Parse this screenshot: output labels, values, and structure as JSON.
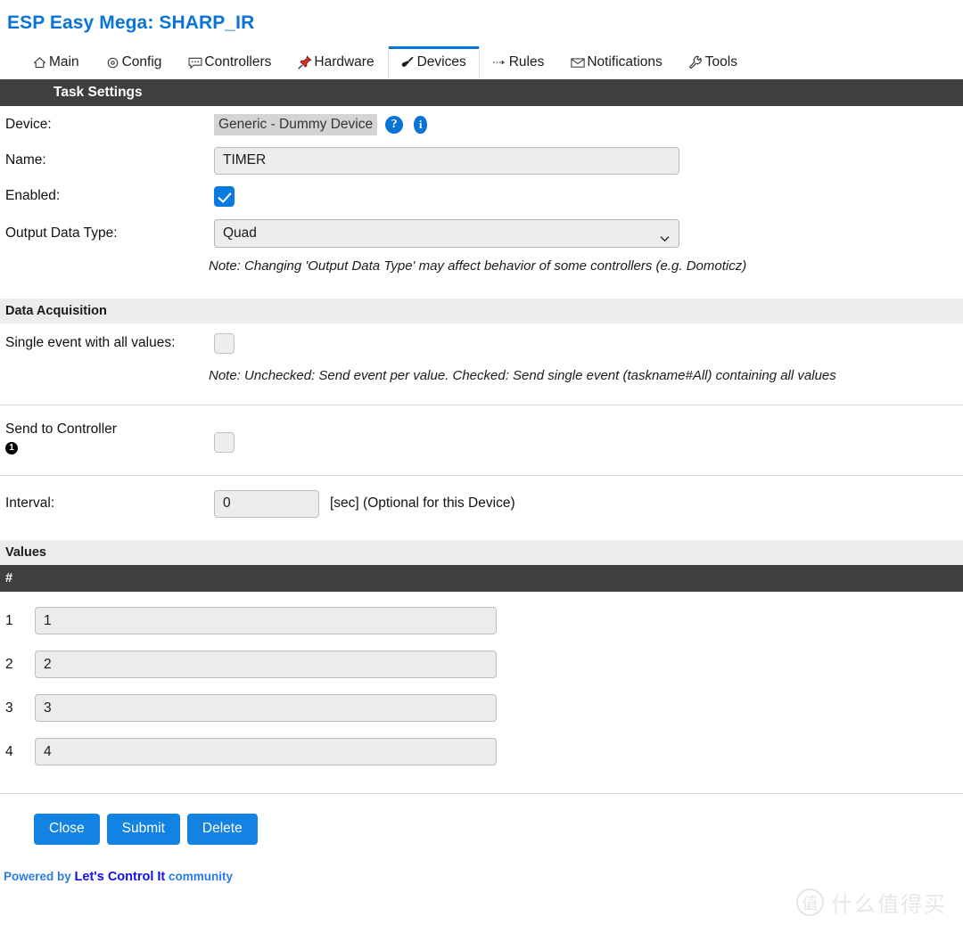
{
  "header": {
    "title": "ESP Easy Mega: SHARP_IR"
  },
  "tabs": [
    {
      "label": "Main",
      "icon": "home-icon",
      "active": false
    },
    {
      "label": "Config",
      "icon": "gear-icon",
      "active": false
    },
    {
      "label": "Controllers",
      "icon": "chat-icon",
      "active": false
    },
    {
      "label": "Hardware",
      "icon": "pushpin-icon",
      "active": false
    },
    {
      "label": "Devices",
      "icon": "plug-icon",
      "active": true
    },
    {
      "label": "Rules",
      "icon": "arrow-icon",
      "active": false
    },
    {
      "label": "Notifications",
      "icon": "envelope-icon",
      "active": false
    },
    {
      "label": "Tools",
      "icon": "wrench-icon",
      "active": false
    }
  ],
  "task_settings": {
    "section_title": "Task Settings",
    "device_label": "Device:",
    "device_value": "Generic - Dummy Device",
    "help_icon_label": "?",
    "info_icon_label": "i",
    "name_label": "Name:",
    "name_value": "TIMER",
    "enabled_label": "Enabled:",
    "enabled_checked": true,
    "output_data_type_label": "Output Data Type:",
    "output_data_type_value": "Quad",
    "output_data_type_note": "Note: Changing 'Output Data Type' may affect behavior of some controllers (e.g. Domoticz)"
  },
  "data_acquisition": {
    "section_title": "Data Acquisition",
    "single_event_label": "Single event with all values:",
    "single_event_checked": false,
    "single_event_note": "Note: Unchecked: Send event per value. Checked: Send single event (taskname#All) containing all values",
    "send_to_controller_label": "Send to Controller",
    "send_to_controller_index": "1",
    "send_to_controller_checked": false,
    "interval_label": "Interval:",
    "interval_value": "0",
    "interval_suffix": "[sec] (Optional for this Device)"
  },
  "values": {
    "section_title": "Values",
    "column_header": "#",
    "rows": [
      {
        "index": "1",
        "value": "1"
      },
      {
        "index": "2",
        "value": "2"
      },
      {
        "index": "3",
        "value": "3"
      },
      {
        "index": "4",
        "value": "4"
      }
    ]
  },
  "buttons": {
    "close": "Close",
    "submit": "Submit",
    "delete": "Delete"
  },
  "footer": {
    "prefix": "Powered by ",
    "brand": "Let's Control It",
    "suffix": " community"
  },
  "watermark": {
    "logo": "值",
    "text": "什么值得买"
  },
  "colors": {
    "accent": "#0a73d6",
    "button": "#1283e2",
    "dark_bar": "#3f3f3f",
    "light_bar": "#ececec",
    "input_bg": "#ececec"
  }
}
